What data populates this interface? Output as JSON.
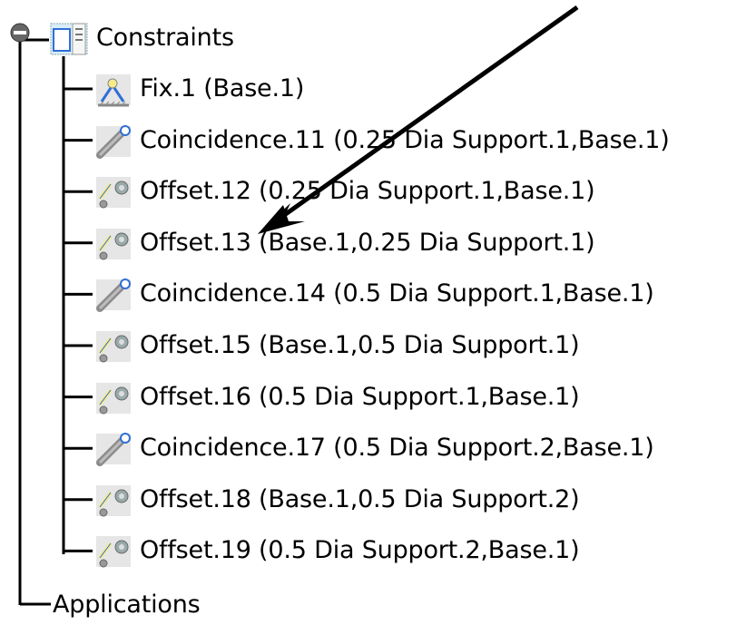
{
  "tree": {
    "root": {
      "label": "Constraints",
      "icon": "constraints-folder-icon",
      "expanded": true
    },
    "children": [
      {
        "label": "Fix.1 (Base.1)",
        "icon": "fix-constraint-icon"
      },
      {
        "label": "Coincidence.11 (0.25 Dia Support.1,Base.1)",
        "icon": "coincidence-constraint-icon"
      },
      {
        "label": "Offset.12 (0.25 Dia Support.1,Base.1)",
        "icon": "offset-constraint-icon"
      },
      {
        "label": "Offset.13 (Base.1,0.25 Dia Support.1)",
        "icon": "offset-constraint-icon"
      },
      {
        "label": "Coincidence.14 (0.5 Dia Support.1,Base.1)",
        "icon": "coincidence-constraint-icon"
      },
      {
        "label": "Offset.15 (Base.1,0.5 Dia Support.1)",
        "icon": "offset-constraint-icon"
      },
      {
        "label": "Offset.16 (0.5 Dia Support.1,Base.1)",
        "icon": "offset-constraint-icon"
      },
      {
        "label": "Coincidence.17 (0.5 Dia Support.2,Base.1)",
        "icon": "coincidence-constraint-icon"
      },
      {
        "label": "Offset.18 (Base.1,0.5 Dia Support.2)",
        "icon": "offset-constraint-icon"
      },
      {
        "label": "Offset.19 (0.5 Dia Support.2,Base.1)",
        "icon": "offset-constraint-icon"
      }
    ],
    "sibling": {
      "label": "Applications"
    }
  },
  "annotation": {
    "type": "arrow",
    "points_to": "Offset.13 (Base.1,0.25 Dia Support.1)"
  },
  "colors": {
    "line": "#000000",
    "icon_yellow": "#f4ec8a",
    "icon_blue": "#2f6fd6",
    "icon_gray": "#8c8c8c"
  }
}
